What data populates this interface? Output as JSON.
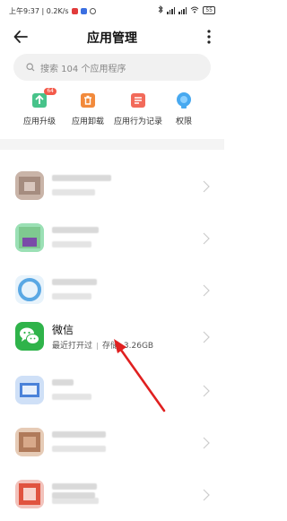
{
  "status_bar": {
    "time_speed": "上午9:37 | 0.2K/s",
    "battery": "55"
  },
  "header": {
    "title": "应用管理"
  },
  "search": {
    "placeholder": "搜索 104 个应用程序"
  },
  "tools": [
    {
      "label": "应用升级",
      "icon": "app-update-icon",
      "badge": "64",
      "color": "#47c38a"
    },
    {
      "label": "应用卸载",
      "icon": "trash-icon",
      "color": "#f28a3c"
    },
    {
      "label": "应用行为记录",
      "icon": "record-icon",
      "color": "#f26a5a"
    },
    {
      "label": "权限",
      "icon": "permission-icon",
      "color": "#48a9f0"
    }
  ],
  "apps": {
    "wechat": {
      "name": "微信",
      "last_opened": "最近打开过",
      "storage": "存储: 3.26GB"
    }
  },
  "colors": {
    "wechat_green": "#2fb34a",
    "arrow_red": "#e02020"
  }
}
